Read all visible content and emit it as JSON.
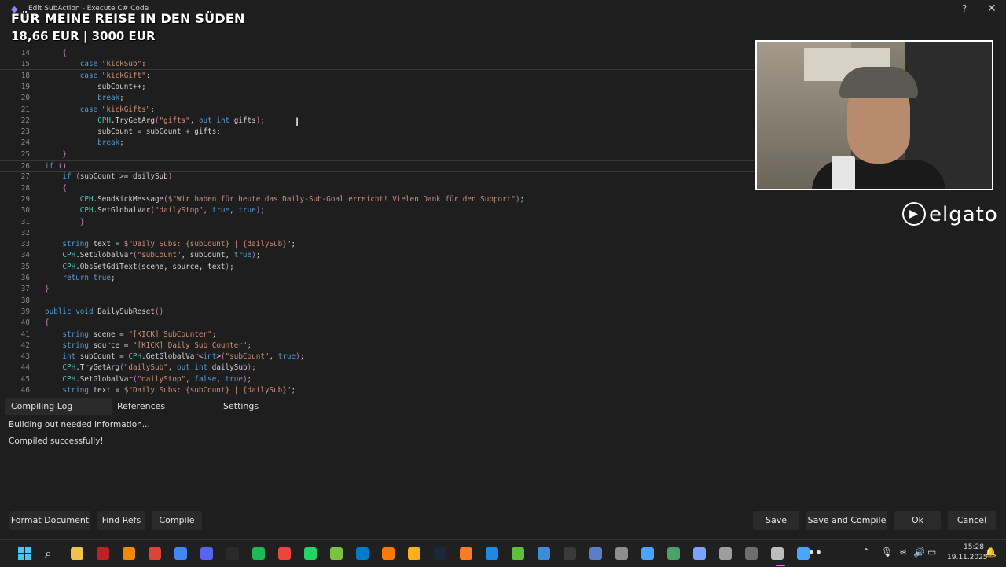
{
  "window": {
    "title": "Edit SubAction - Execute C# Code",
    "help_glyph": "?",
    "close_glyph": "✕"
  },
  "overlay": {
    "goal_text": "FÜR MEINE REISE IN DEN SÜDEN",
    "amount_text": "18,66 EUR | 3000 EUR"
  },
  "editor": {
    "lines": [
      {
        "n": "14",
        "t": "        {"
      },
      {
        "n": "15",
        "t": "            case \"kickSub\":"
      },
      {
        "n": "18",
        "t": "            case \"kickGift\":"
      },
      {
        "n": "19",
        "t": "                subCount++;"
      },
      {
        "n": "20",
        "t": "                break;"
      },
      {
        "n": "21",
        "t": "            case \"kickGifts\":"
      },
      {
        "n": "22",
        "t": "                CPH.TryGetArg(\"gifts\", out int gifts);"
      },
      {
        "n": "23",
        "t": "                subCount = subCount + gifts;"
      },
      {
        "n": "24",
        "t": "                break;"
      },
      {
        "n": "25",
        "t": "        }"
      },
      {
        "n": "26",
        "t": "if ()"
      },
      {
        "n": "27",
        "t": "        if (subCount >= dailySub)"
      },
      {
        "n": "28",
        "t": "        {"
      },
      {
        "n": "29",
        "t": "            CPH.SendKickMessage($\"Wir haben für heute das Daily-Sub-Goal erreicht! Vielen Dank für den Support\");"
      },
      {
        "n": "30",
        "t": "            CPH.SetGlobalVar(\"dailyStop\", true, true);"
      },
      {
        "n": "31",
        "t": "            }"
      },
      {
        "n": "32",
        "t": ""
      },
      {
        "n": "33",
        "t": "        string text = $\"Daily Subs: {subCount} | {dailySub}\";"
      },
      {
        "n": "34",
        "t": "        CPH.SetGlobalVar(\"subCount\", subCount, true);"
      },
      {
        "n": "35",
        "t": "        CPH.ObsSetGdiText(scene, source, text);"
      },
      {
        "n": "36",
        "t": "        return true;"
      },
      {
        "n": "37",
        "t": "    }"
      },
      {
        "n": "38",
        "t": ""
      },
      {
        "n": "39",
        "t": "    public void DailySubReset()"
      },
      {
        "n": "40",
        "t": "    {"
      },
      {
        "n": "41",
        "t": "        string scene = \"[KICK] SubCounter\";"
      },
      {
        "n": "42",
        "t": "        string source = \"[KICK] Daily Sub Counter\";"
      },
      {
        "n": "43",
        "t": "        int subCount = CPH.GetGlobalVar<int>(\"subCount\", true);"
      },
      {
        "n": "44",
        "t": "        CPH.TryGetArg(\"dailySub\", out int dailySub);"
      },
      {
        "n": "45",
        "t": "        CPH.SetGlobalVar(\"dailyStop\", false, true);"
      },
      {
        "n": "46",
        "t": "        string text = $\"Daily Subs: {subCount} | {dailySub}\";"
      }
    ],
    "current_line": "26"
  },
  "webcam": {
    "brand_label": "elgato",
    "brand_icon": "elgato-play-icon"
  },
  "bottom_panel": {
    "tabs": [
      "Compiling Log",
      "References",
      "Settings"
    ],
    "active_tab": "Compiling Log",
    "log": [
      "Building out needed information...",
      "Compiled successfully!"
    ]
  },
  "buttons": {
    "format_document": "Format Document",
    "find_refs": "Find Refs",
    "compile": "Compile",
    "save": "Save",
    "save_and_compile": "Save and Compile",
    "ok": "Ok",
    "cancel": "Cancel"
  },
  "taskbar": {
    "time": "15:28",
    "date": "19.11.2025",
    "apps": [
      {
        "name": "file-explorer-icon",
        "color": "#f2c14e"
      },
      {
        "name": "filezilla-icon",
        "color": "#bf2024"
      },
      {
        "name": "vlc-icon",
        "color": "#f08a00"
      },
      {
        "name": "chrome-icon",
        "color": "#db4437"
      },
      {
        "name": "chrome-profile-icon",
        "color": "#4285f4"
      },
      {
        "name": "discord-icon",
        "color": "#5865f2"
      },
      {
        "name": "epic-games-icon",
        "color": "#2a2a2a"
      },
      {
        "name": "spotify-icon",
        "color": "#1db954"
      },
      {
        "name": "anydesk-icon",
        "color": "#ef443b"
      },
      {
        "name": "whatsapp-icon",
        "color": "#25d366"
      },
      {
        "name": "notepad-plus-icon",
        "color": "#7cc242"
      },
      {
        "name": "vscode-icon",
        "color": "#007acc"
      },
      {
        "name": "avast-icon",
        "color": "#ff7800"
      },
      {
        "name": "rockstar-icon",
        "color": "#fcaf17"
      },
      {
        "name": "steam-icon",
        "color": "#1b2838"
      },
      {
        "name": "xampp-icon",
        "color": "#fb7a24"
      },
      {
        "name": "app-blue-icon",
        "color": "#1e88e5"
      },
      {
        "name": "cube-icon",
        "color": "#5fbf3a"
      },
      {
        "name": "blue-orb-icon",
        "color": "#3d8ed8"
      },
      {
        "name": "dark-app-icon",
        "color": "#3a3a3a"
      },
      {
        "name": "tool-icon",
        "color": "#5b7dc8"
      },
      {
        "name": "chrome-alt-icon",
        "color": "#8e8e8e"
      },
      {
        "name": "streamerbot-icon",
        "color": "#4aa3ff"
      },
      {
        "name": "green-tool-icon",
        "color": "#47a36b"
      },
      {
        "name": "audio-app-icon",
        "color": "#7aa3ff"
      },
      {
        "name": "settings-icon",
        "color": "#9e9e9e"
      },
      {
        "name": "terminal-icon",
        "color": "#6e6e6e"
      },
      {
        "name": "arrow-app-icon",
        "color": "#bdbdbd"
      },
      {
        "name": "streamerbot-active-icon",
        "color": "#4aa3ff"
      }
    ]
  }
}
